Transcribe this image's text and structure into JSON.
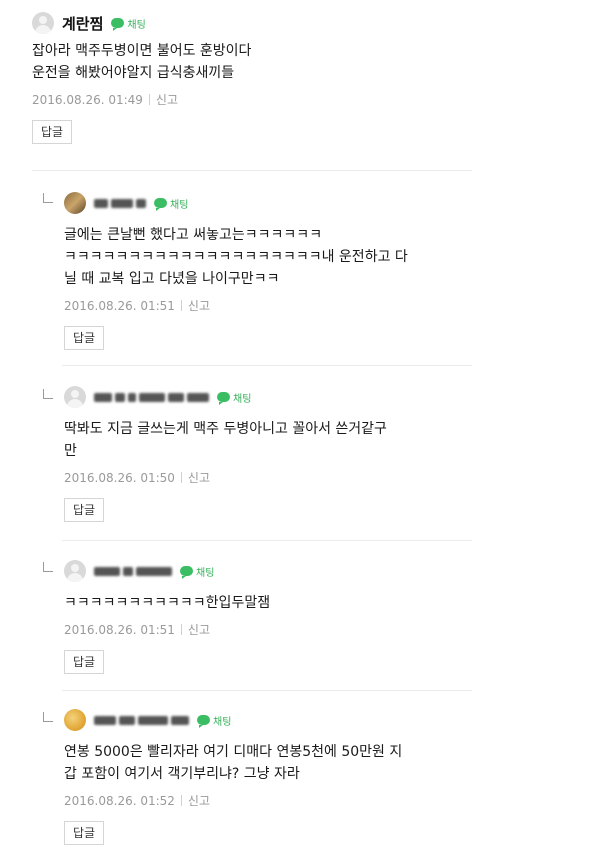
{
  "chat_label": "채팅",
  "reply_label": "답글",
  "report_label": "신고",
  "comments": [
    {
      "author": "계란찜",
      "text": "잡아라 맥주두병이면 불어도 훈방이다\n운전을 해봤어야알지 급식충새끼들",
      "time": "2016.08.26. 01:49"
    },
    {
      "author": "",
      "text": "글에는 큰날뻔 했다고 써놓고는ㅋㅋㅋㅋㅋㅋ\nㅋㅋㅋㅋㅋㅋㅋㅋㅋㅋㅋㅋㅋㅋㅋㅋㅋㅋㅋㅋ내 운전하고 다\n닐 때 교복 입고 다녔을 나이구만ㅋㅋ",
      "time": "2016.08.26. 01:51"
    },
    {
      "author": "",
      "text": "딱봐도 지금 글쓰는게 맥주 두병아니고 꼴아서 쓴거같구\n만",
      "time": "2016.08.26. 01:50"
    },
    {
      "author": "",
      "text": "ㅋㅋㅋㅋㅋㅋㅋㅋㅋㅋㅋ한입두말잼",
      "time": "2016.08.26. 01:51"
    },
    {
      "author": "",
      "text": "연봉 5000은 빨리자라 여기 디매다 연봉5천에 50만원 지\n갑 포함이 여기서 객기부리냐? 그냥 자라",
      "time": "2016.08.26. 01:52"
    }
  ]
}
